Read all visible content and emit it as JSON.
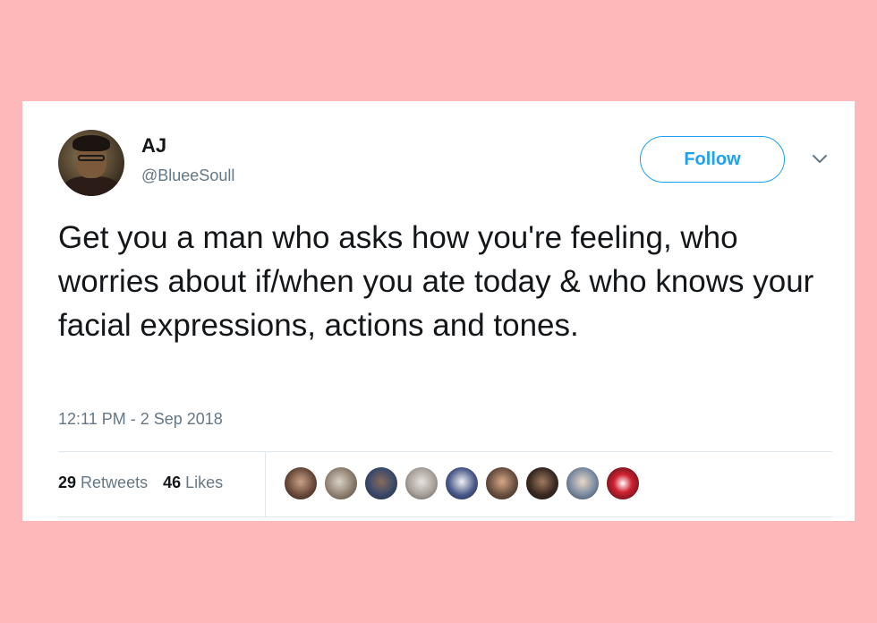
{
  "tweet": {
    "author_name": "AJ",
    "author_handle": "@BlueeSoull",
    "follow_label": "Follow",
    "text": "Get you a man who asks how you're feeling, who worries about if/when you ate today & who knows your facial expressions, actions and tones.",
    "timestamp": "12:11 PM - 2 Sep 2018",
    "retweets_count": "29",
    "retweets_label": "Retweets",
    "likes_count": "46",
    "likes_label": "Likes"
  },
  "icons": {
    "menu_caret": "chevron-down-icon"
  },
  "colors": {
    "background": "#ffb8b9",
    "accent": "#1da1f2",
    "text_primary": "#14171a",
    "text_secondary": "#657786"
  }
}
